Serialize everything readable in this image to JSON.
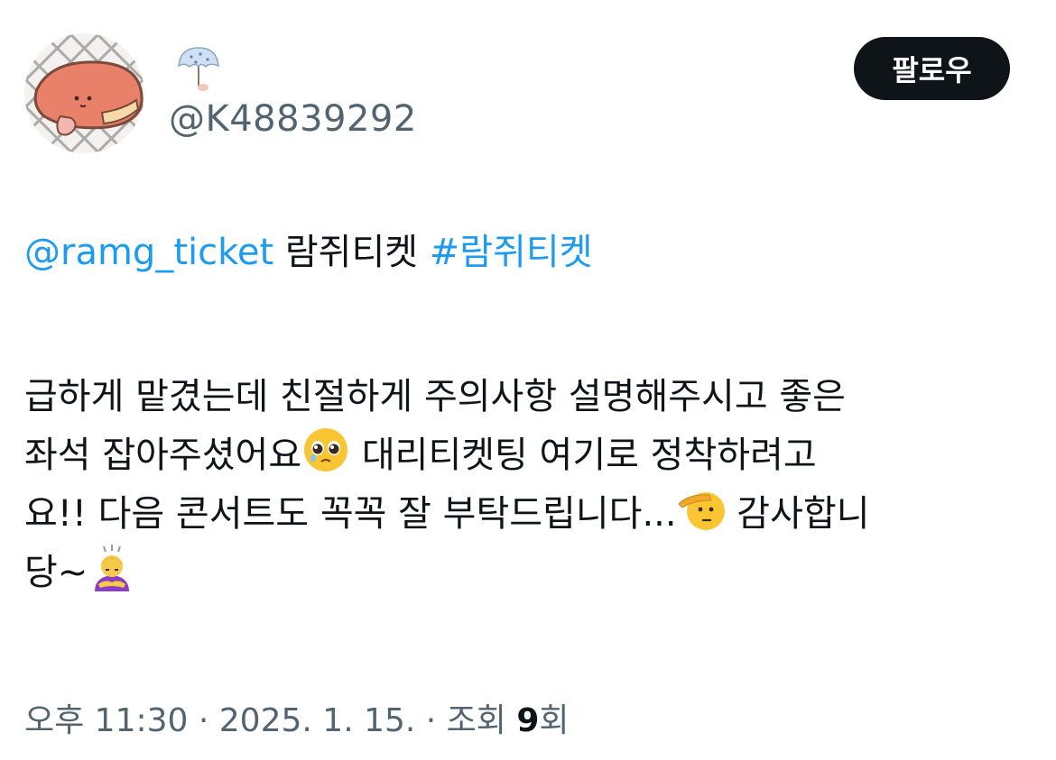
{
  "author": {
    "avatar_icon": "grilled-fish-avatar",
    "name_icon": "umbrella-emoji",
    "handle": "@K48839292"
  },
  "follow_button": {
    "label": "팔로우"
  },
  "tweet": {
    "mention": "@ramg_ticket",
    "mention_text": " 람쥐티켓 ",
    "hashtag": "#람쥐티켓",
    "line1": "급하게 맡겼는데 친절하게 주의사항 설명해주시고 좋은",
    "line2a": "좌석 잡아주셨어요",
    "line2b": " 대리티켓팅 여기로 정착하려고",
    "line3a": "요!! 다음 콘서트도 꼭꼭 잘 부탁드립니다...",
    "line3b": " 감사합니",
    "line4": "당~",
    "emojis": [
      "pleading-face-emoji",
      "saluting-face-emoji",
      "bowing-person-emoji"
    ]
  },
  "meta": {
    "time": "오후 11:30",
    "separator": " · ",
    "date": "2025. 1. 15.",
    "views_label": "조회 ",
    "views_count": "9",
    "views_suffix": "회"
  },
  "colors": {
    "link": "#1d9bf0",
    "text": "#0f1419",
    "secondary": "#536471",
    "button_bg": "#0f1419",
    "button_text": "#ffffff"
  }
}
